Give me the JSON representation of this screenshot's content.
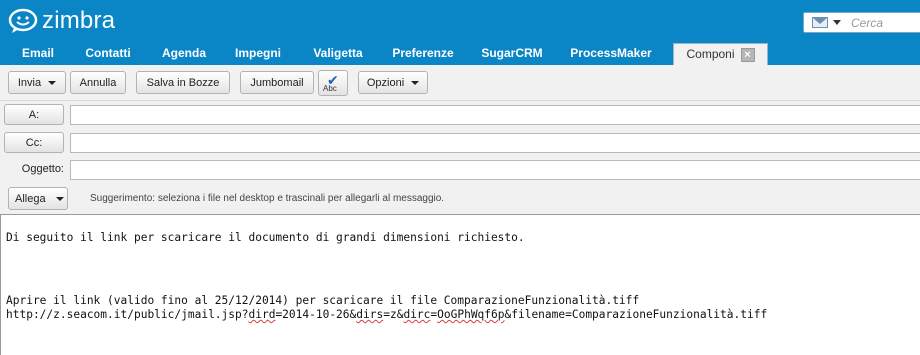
{
  "app": {
    "logo_text": "zimbra"
  },
  "search": {
    "placeholder": "Cerca"
  },
  "app_tabs": [
    {
      "label": "Email"
    },
    {
      "label": "Contatti"
    },
    {
      "label": "Agenda"
    },
    {
      "label": "Impegni"
    },
    {
      "label": "Valigetta"
    },
    {
      "label": "Preferenze"
    },
    {
      "label": "SugarCRM"
    },
    {
      "label": "ProcessMaker"
    },
    {
      "label": "Componi",
      "active": true
    }
  ],
  "toolbar": {
    "send_label": "Invia",
    "cancel_label": "Annulla",
    "save_draft_label": "Salva in Bozze",
    "jumbomail_label": "Jumbomail",
    "spellcheck_label": "Abc",
    "options_label": "Opzioni"
  },
  "fields": {
    "to_label": "A:",
    "cc_label": "Cc:",
    "subject_label": "Oggetto:",
    "to_value": "",
    "cc_value": "",
    "subject_value": "",
    "attach_label": "Allega",
    "attach_hint": "Suggerimento: seleziona i file nel desktop e trascinali per allegarli al messaggio."
  },
  "message": {
    "line1": "Di seguito il link per scaricare il documento di grandi dimensioni richiesto.",
    "line2": "Aprire il link (valido fino al 25/12/2014) per scaricare il file ComparazioneFunzionalità.tiff",
    "line3_a": "http://z.seacom.it/public/jmail.jsp?",
    "line3_b": "dird",
    "line3_c": "=2014-10-26&",
    "line3_d": "dirs",
    "line3_e": "=z&",
    "line3_f": "dirc",
    "line3_g": "=",
    "line3_h": "OoGPhWqf6p",
    "line3_i": "&filename=ComparazioneFunzionalità.tiff"
  },
  "colors": {
    "header_blue": "#0a86c7",
    "toolbar_gray": "#f1f1f1"
  }
}
